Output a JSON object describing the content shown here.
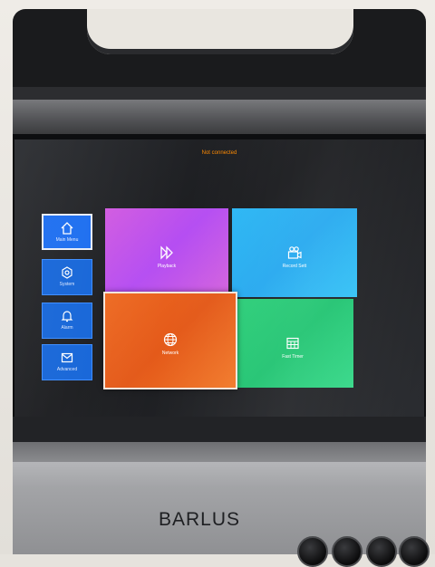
{
  "status_text": "Not connected",
  "sidebar": {
    "items": [
      {
        "label": "Main Menu",
        "icon": "home-icon",
        "selected": true
      },
      {
        "label": "System",
        "icon": "gear-icon"
      },
      {
        "label": "Alarm",
        "icon": "bell-icon"
      },
      {
        "label": "Advanced",
        "icon": "envelope-icon"
      }
    ]
  },
  "tiles": {
    "playback": {
      "label": "Playback",
      "icon": "fast-forward-icon",
      "color": "#c756e8"
    },
    "record": {
      "label": "Record Sett",
      "icon": "video-camera-icon",
      "color": "#2cb7f4"
    },
    "network": {
      "label": "Network",
      "icon": "globe-icon",
      "color": "#ee6a22",
      "selected": true
    },
    "fast": {
      "label": "Fast Timer",
      "icon": "calendar-grid-icon",
      "color": "#2ecf7a"
    }
  },
  "device": {
    "brand": "BARLUS"
  },
  "colors": {
    "status_text": "#ff8a00",
    "sidebar_bg": "#1565d8"
  }
}
